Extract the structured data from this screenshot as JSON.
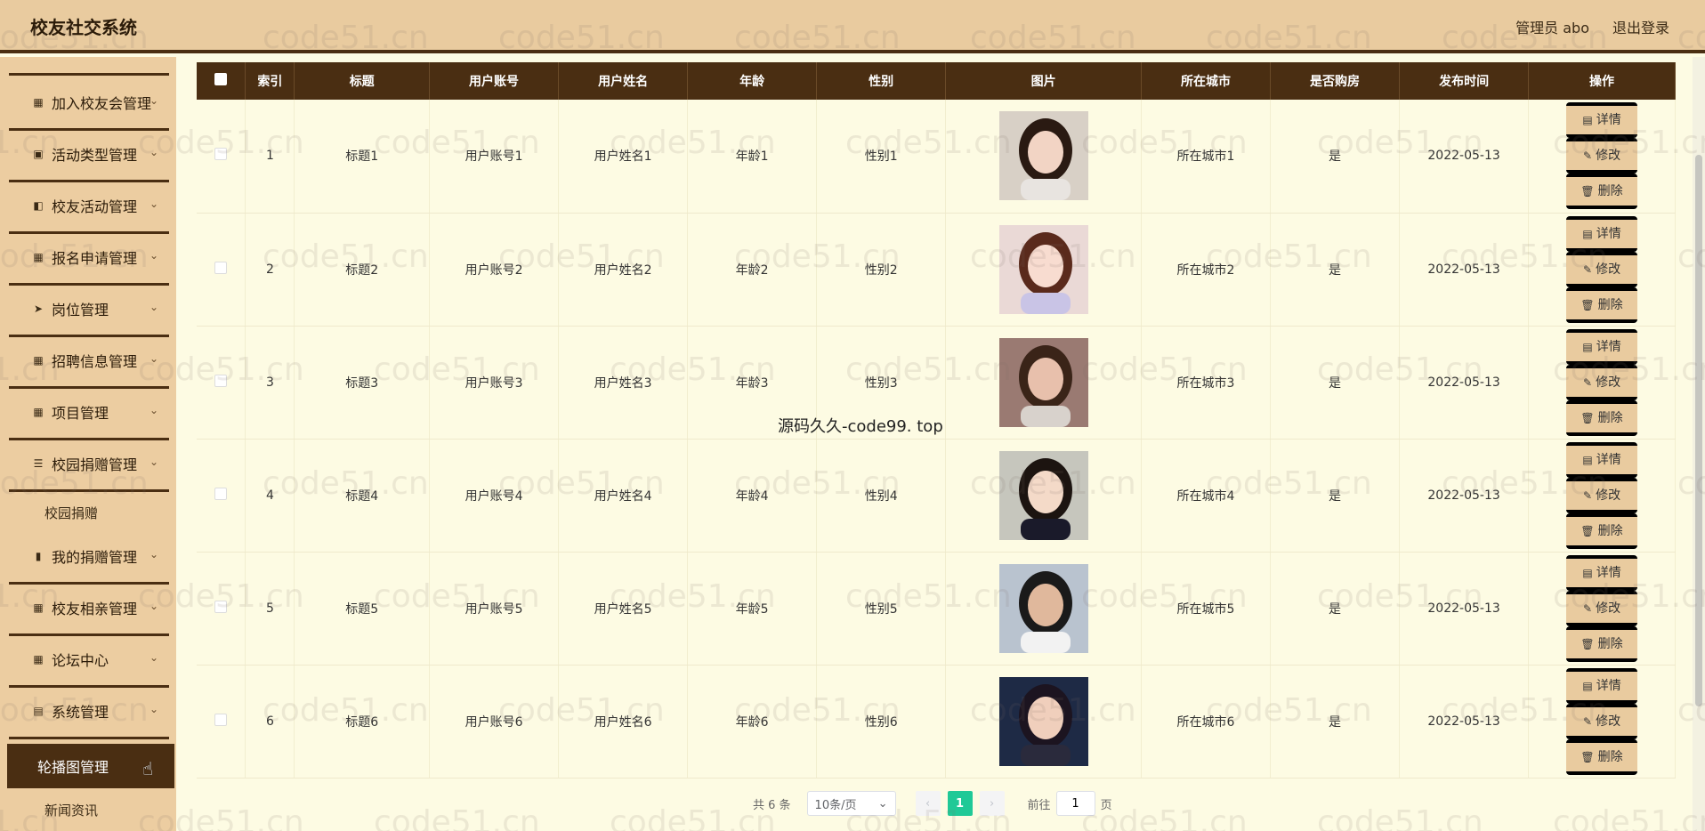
{
  "header": {
    "brand": "校友社交系统",
    "user_label": "管理员 abo",
    "logout_label": "退出登录"
  },
  "sidebar": {
    "menus": [
      {
        "label": "加入校友会管理",
        "icon": "▦"
      },
      {
        "label": "活动类型管理",
        "icon": "▣"
      },
      {
        "label": "校友活动管理",
        "icon": "◧"
      },
      {
        "label": "报名申请管理",
        "icon": "▦"
      },
      {
        "label": "岗位管理",
        "icon": "➤"
      },
      {
        "label": "招聘信息管理",
        "icon": "▦"
      },
      {
        "label": "项目管理",
        "icon": "▦"
      },
      {
        "label": "校园捐赠管理",
        "icon": "☰"
      },
      {
        "label": "我的捐赠管理",
        "icon": "▮"
      },
      {
        "label": "校友相亲管理",
        "icon": "▦"
      },
      {
        "label": "论坛中心",
        "icon": "▦"
      },
      {
        "label": "系统管理",
        "icon": "▤"
      }
    ],
    "sub_donation": "校园捐赠",
    "active": "轮播图管理",
    "sub_news": "新闻资讯"
  },
  "table": {
    "headers": [
      "索引",
      "标题",
      "用户账号",
      "用户姓名",
      "年龄",
      "性别",
      "图片",
      "所在城市",
      "是否购房",
      "发布时间",
      "操作"
    ],
    "rows": [
      {
        "index": "1",
        "title": "标题1",
        "account": "用户账号1",
        "name": "用户姓名1",
        "age": "年龄1",
        "gender": "性别1",
        "image": "photo-woman-1",
        "city": "所在城市1",
        "house": "是",
        "date": "2022-05-13"
      },
      {
        "index": "2",
        "title": "标题2",
        "account": "用户账号2",
        "name": "用户姓名2",
        "age": "年龄2",
        "gender": "性别2",
        "image": "photo-woman-2",
        "city": "所在城市2",
        "house": "是",
        "date": "2022-05-13"
      },
      {
        "index": "3",
        "title": "标题3",
        "account": "用户账号3",
        "name": "用户姓名3",
        "age": "年龄3",
        "gender": "性别3",
        "image": "photo-woman-3",
        "city": "所在城市3",
        "house": "是",
        "date": "2022-05-13"
      },
      {
        "index": "4",
        "title": "标题4",
        "account": "用户账号4",
        "name": "用户姓名4",
        "age": "年龄4",
        "gender": "性别4",
        "image": "photo-woman-4",
        "city": "所在城市4",
        "house": "是",
        "date": "2022-05-13"
      },
      {
        "index": "5",
        "title": "标题5",
        "account": "用户账号5",
        "name": "用户姓名5",
        "age": "年龄5",
        "gender": "性别5",
        "image": "photo-man-5",
        "city": "所在城市5",
        "house": "是",
        "date": "2022-05-13"
      },
      {
        "index": "6",
        "title": "标题6",
        "account": "用户账号6",
        "name": "用户姓名6",
        "age": "年龄6",
        "gender": "性别6",
        "image": "photo-woman-6",
        "city": "所在城市6",
        "house": "是",
        "date": "2022-05-13"
      }
    ],
    "actions": {
      "detail": "详情",
      "edit": "修改",
      "delete": "删除"
    }
  },
  "pagination": {
    "total": "共 6 条",
    "page_size": "10条/页",
    "current_page": "1",
    "goto_prefix": "前往",
    "goto_value": "1",
    "goto_suffix": "页"
  },
  "watermark": {
    "text": "code51.cn",
    "center": "源码久久-code99. top"
  },
  "colors": {
    "header_bg": "#e9cb9f",
    "accent_dark": "#4a2e12",
    "content_bg": "#fdfbe3",
    "page_active": "#20c997"
  }
}
